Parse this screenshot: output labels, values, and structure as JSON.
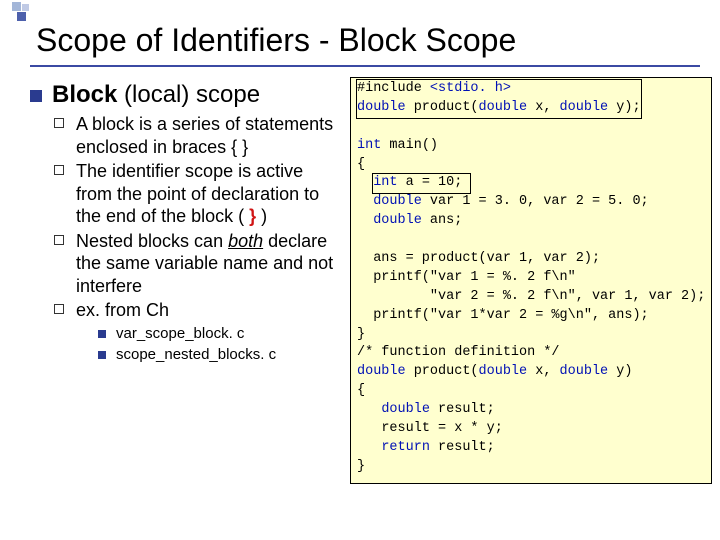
{
  "title": "Scope of Identifiers - Block Scope",
  "subhead_bold": "Block",
  "subhead_rest": " (local) scope",
  "bullets": [
    "A block is a series of statements enclosed in braces { }",
    "The identifier scope is active from the point of declaration to the end of the block ( ",
    "Nested blocks can ",
    "ex. from Ch"
  ],
  "bullet1_tail": " )",
  "both_word": "both",
  "bullet2_tail": " declare the same variable name and not interfere",
  "sub_bullets": [
    "var_scope_block. c",
    "scope_nested_blocks. c"
  ],
  "code": {
    "l01a": "#include ",
    "l01b": "<stdio. h>",
    "l02a": "double",
    "l02b": " product(",
    "l02c": "double",
    "l02d": " x, ",
    "l02e": "double",
    "l02f": " y);",
    "l04a": "int",
    "l04b": " main()",
    "l05": "{",
    "l06a": "int",
    "l06b": " a = 10;",
    "l07a": "double",
    "l07b": " var 1 = 3. 0, var 2 = 5. 0;",
    "l08a": "double",
    "l08b": " ans;",
    "l10": "ans = product(var 1, var 2);",
    "l11": "printf(\"var 1 = %. 2 f\\n\"",
    "l12": "       \"var 2 = %. 2 f\\n\", var 1, var 2);",
    "l13": "printf(\"var 1*var 2 = %g\\n\", ans);",
    "l14": "}",
    "l15": "/* function definition */",
    "l16a": "double",
    "l16b": " product(",
    "l16c": "double",
    "l16d": " x, ",
    "l16e": "double",
    "l16f": " y)",
    "l17": "{",
    "l18a": "double",
    "l18b": " result;",
    "l19": "result = x * y;",
    "l20a": "return",
    "l20b": " result;",
    "l21": "}"
  }
}
